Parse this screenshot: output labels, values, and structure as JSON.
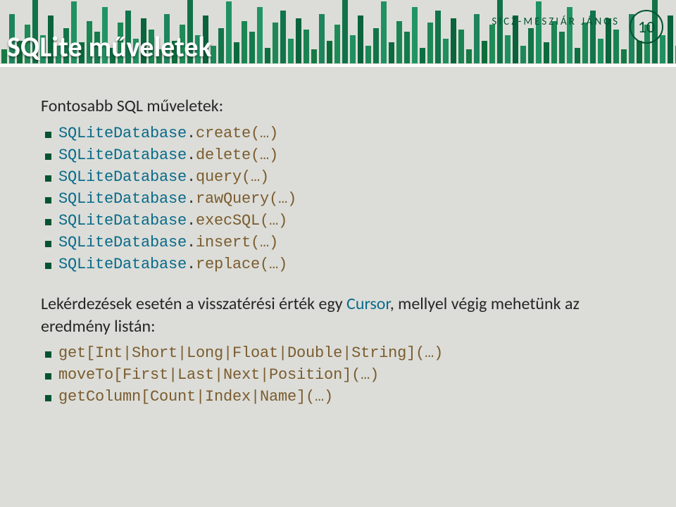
{
  "header": {
    "author": "SICZ-MESZIÁR JÁNOS",
    "page_number": "10",
    "title": "SQLite műveletek"
  },
  "section1": {
    "heading": "Fontosabb SQL műveletek:",
    "items": [
      {
        "cls": "SQLiteDatabase",
        "dot": ".",
        "mtd": "create(…)"
      },
      {
        "cls": "SQLiteDatabase",
        "dot": ".",
        "mtd": "delete(…)"
      },
      {
        "cls": "SQLiteDatabase",
        "dot": ".",
        "mtd": "query(…)"
      },
      {
        "cls": "SQLiteDatabase",
        "dot": ".",
        "mtd": "rawQuery(…)"
      },
      {
        "cls": "SQLiteDatabase",
        "dot": ".",
        "mtd": "execSQL(…)"
      },
      {
        "cls": "SQLiteDatabase",
        "dot": ".",
        "mtd": "insert(…)"
      },
      {
        "cls": "SQLiteDatabase",
        "dot": ".",
        "mtd": "replace(…)"
      }
    ]
  },
  "section2": {
    "para_pre": "Lekérdezések esetén a visszatérési érték egy ",
    "para_cursor": "Cursor",
    "para_post": ", mellyel végig mehetünk az eredmény listán:",
    "items": [
      {
        "text": "get[Int|Short|Long|Float|Double|String](…)"
      },
      {
        "text": "moveTo[First|Last|Next|Position](…)"
      },
      {
        "text": "getColumn[Count|Index|Name](…)"
      }
    ]
  },
  "bars": {
    "colors": [
      "#167a45",
      "#1e845c",
      "#0d6d3a",
      "#1f8a56",
      "#117248",
      "#208f60",
      "#0a633b",
      "#1d8857",
      "#13744a",
      "#209161",
      "#0c6a3f",
      "#1b8554",
      "#157a4b",
      "#229463",
      "#0e6f42",
      "#1d8856",
      "#11744a",
      "#1f8f5e",
      "#0a643c",
      "#1a8352"
    ],
    "heights": [
      20,
      70,
      32,
      55,
      90,
      40,
      68,
      25,
      50,
      88,
      30,
      60,
      45,
      80,
      22,
      58,
      75,
      35,
      64,
      48
    ]
  }
}
